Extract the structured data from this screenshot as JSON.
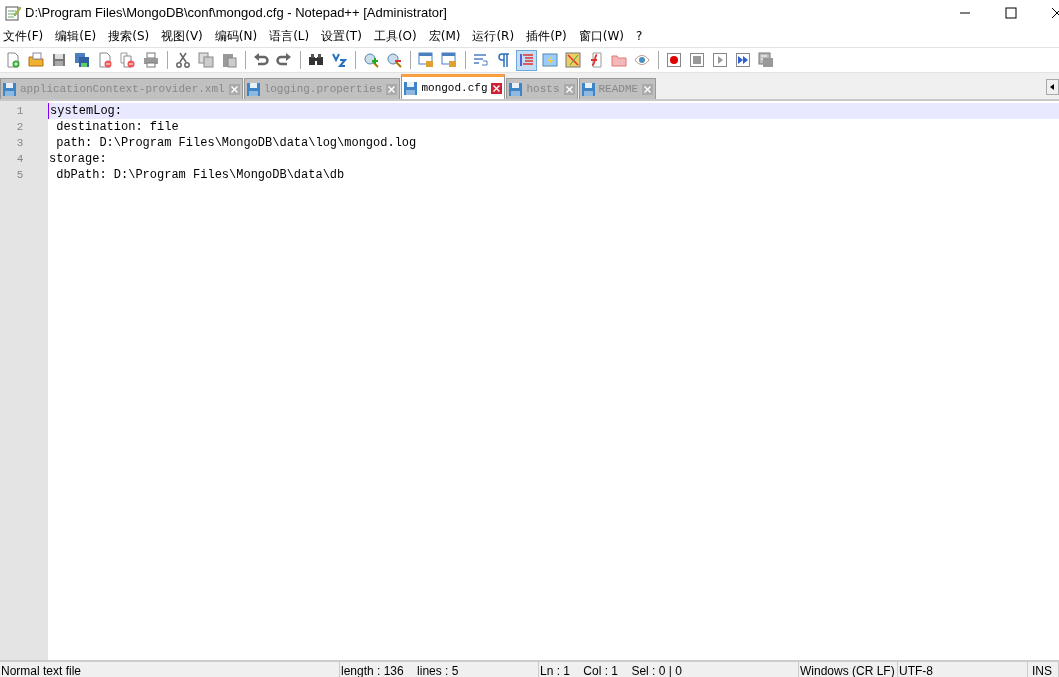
{
  "window": {
    "title": "D:\\Program Files\\MongoDB\\conf\\mongod.cfg - Notepad++ [Administrator]"
  },
  "menu": [
    "文件(F)",
    "编辑(E)",
    "搜索(S)",
    "视图(V)",
    "编码(N)",
    "语言(L)",
    "设置(T)",
    "工具(O)",
    "宏(M)",
    "运行(R)",
    "插件(P)",
    "窗口(W)",
    "?"
  ],
  "toolbar": [
    {
      "kind": "new",
      "on": false
    },
    {
      "kind": "open",
      "on": false
    },
    {
      "kind": "save",
      "on": false
    },
    {
      "kind": "saveall",
      "on": false
    },
    {
      "kind": "close",
      "on": false
    },
    {
      "kind": "closeall",
      "on": false
    },
    {
      "kind": "print",
      "on": false
    },
    {
      "kind": "sep"
    },
    {
      "kind": "cut",
      "on": false
    },
    {
      "kind": "copy",
      "on": false
    },
    {
      "kind": "paste",
      "on": false
    },
    {
      "kind": "sep"
    },
    {
      "kind": "undo",
      "on": false
    },
    {
      "kind": "redo",
      "on": false
    },
    {
      "kind": "sep"
    },
    {
      "kind": "find",
      "on": false
    },
    {
      "kind": "replace",
      "on": false
    },
    {
      "kind": "sep"
    },
    {
      "kind": "zoomin",
      "on": false
    },
    {
      "kind": "zoomout",
      "on": false
    },
    {
      "kind": "sep"
    },
    {
      "kind": "sync",
      "on": false
    },
    {
      "kind": "sync",
      "on": false
    },
    {
      "kind": "sep"
    },
    {
      "kind": "wrap",
      "on": false
    },
    {
      "kind": "pilcrow",
      "on": false
    },
    {
      "kind": "indent",
      "on": true
    },
    {
      "kind": "lang",
      "on": false
    },
    {
      "kind": "map",
      "on": false
    },
    {
      "kind": "func",
      "on": false
    },
    {
      "kind": "folder",
      "on": false
    },
    {
      "kind": "eye",
      "on": false
    },
    {
      "kind": "sep"
    },
    {
      "kind": "record",
      "on": false
    },
    {
      "kind": "stop",
      "on": false
    },
    {
      "kind": "play",
      "on": false
    },
    {
      "kind": "playmulti",
      "on": false
    },
    {
      "kind": "savemacro",
      "on": false
    }
  ],
  "tabs": [
    {
      "label": "applicationContext-provider.xml",
      "selected": false
    },
    {
      "label": "logging.properties",
      "selected": false
    },
    {
      "label": "mongod.cfg",
      "selected": true
    },
    {
      "label": "hosts",
      "selected": false
    },
    {
      "label": "README",
      "selected": false
    }
  ],
  "editor": {
    "lines": [
      {
        "number": "1",
        "text": "systemLog:",
        "current": true
      },
      {
        "number": "2",
        "text": " destination: file",
        "current": false
      },
      {
        "number": "3",
        "text": " path: D:\\Program Files\\MongoDB\\data\\log\\mongod.log",
        "current": false
      },
      {
        "number": "4",
        "text": "storage:",
        "current": false
      },
      {
        "number": "5",
        "text": " dbPath: D:\\Program Files\\MongoDB\\data\\db",
        "current": false
      }
    ]
  },
  "status_bar": [
    "Normal text file",
    "length : 136    lines : 5",
    "Ln : 1    Col : 1    Sel : 0 | 0",
    "Windows (CR LF)",
    "UTF-8",
    "INS"
  ]
}
